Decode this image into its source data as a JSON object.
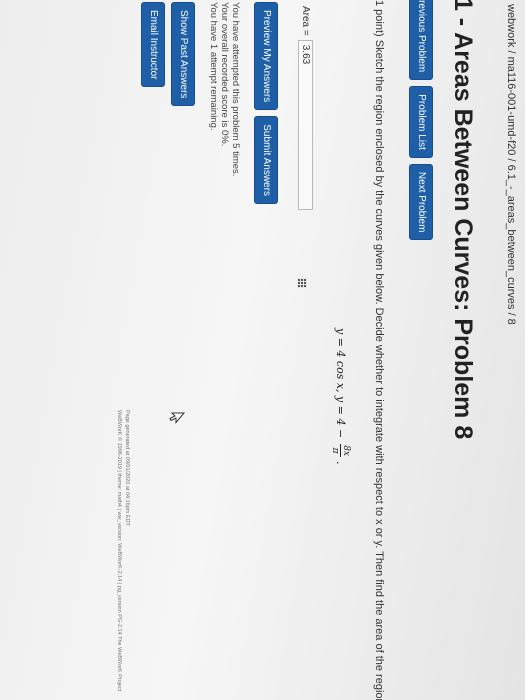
{
  "breadcrumb": "webwork / ma116-001-umd-f20 / 6.1_-_areas_between_curves / 8",
  "title": ".1 - Areas Between Curves: Problem 8",
  "nav": {
    "previous": "revious Problem",
    "problem_list": "Problem List",
    "next": "Next Problem"
  },
  "problem": {
    "text": "1 point) Sketch the region enclosed by the curves given below. Decide whether to integrate with respect to x or y. Then find the area of the region.",
    "eq_part1": "y = 4 cos x,   y = 4 −",
    "frac_num": "8x",
    "frac_den": "π",
    "eq_end": "."
  },
  "answer": {
    "label": "Area =",
    "value": "3.63"
  },
  "buttons": {
    "preview": "Preview My Answers",
    "submit": "Submit Answers",
    "show_past": "Show Past Answers",
    "email": "Email Instructor"
  },
  "status": {
    "line1": "You have attempted this problem 5 times.",
    "line2": "Your overall recorded score is 0%.",
    "line3": "You have 1 attempt remaining."
  },
  "footer": {
    "line1": "Page generated at 09/01/2020 at 04:16pm EDT",
    "line2": "WeBWorK © 1996-2019 | theme: math4 | ww_version: WeBWorK-2.14 | pg_version PG-2.14 The WeBWorK Project"
  }
}
